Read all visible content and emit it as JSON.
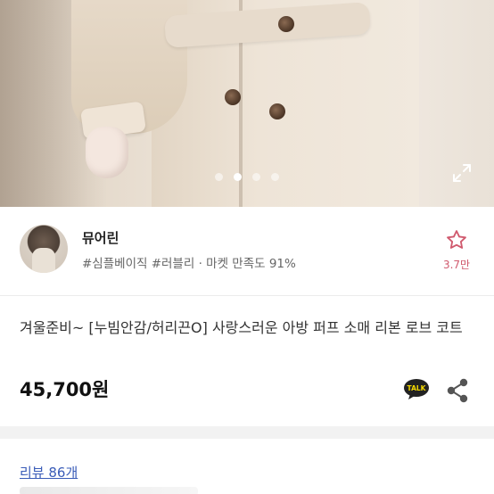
{
  "product_image": {
    "carousel_total": 4,
    "carousel_active": 2,
    "expand_icon": "expand-icon"
  },
  "seller": {
    "name": "뮤어린",
    "tags": "#심플베이직 #러블리 · 마켓 만족도 91%",
    "favorite_icon": "star-outline-icon",
    "favorite_count": "3.7만",
    "accent_color": "#d05a6e"
  },
  "product": {
    "title": "겨울준비~ [누빔안감/허리끈O] 사랑스러운 아방 퍼프 소매 리본 로브 코트",
    "price": "45,700원",
    "talk_label": "TALK",
    "share_icon": "share-icon"
  },
  "reviews": {
    "label": "리뷰 86개",
    "link_color": "#3a5cb8"
  }
}
